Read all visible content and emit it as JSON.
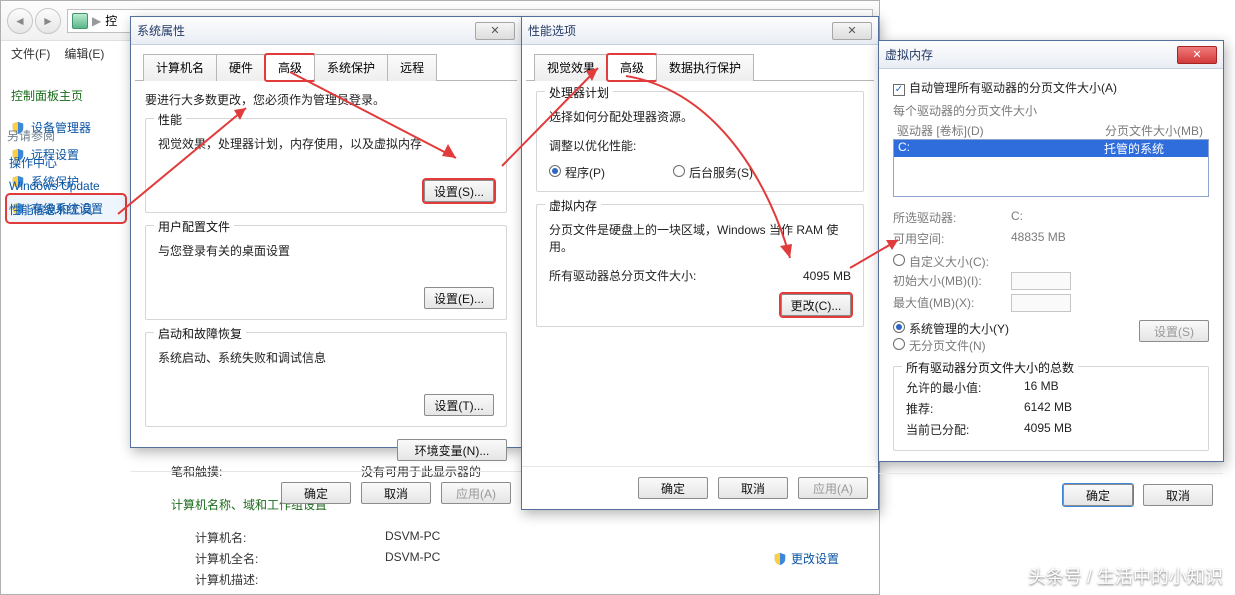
{
  "explorer": {
    "addr_prefix": "▶",
    "addr_text": "控",
    "menu": {
      "file": "文件(F)",
      "edit": "编辑(E)"
    }
  },
  "sidebar": {
    "title": "控制面板主页",
    "items": [
      {
        "label": "设备管理器"
      },
      {
        "label": "远程设置"
      },
      {
        "label": "系统保护"
      },
      {
        "label": "高级系统设置"
      }
    ],
    "footer_title": "另请参阅",
    "footer_items": [
      "操作中心",
      "Windows Update",
      "性能信息和工具"
    ]
  },
  "background": {
    "pen_label": "笔和触摸:",
    "pen_val": "没有可用于此显示器的",
    "cmp_section": "计算机名称、域和工作组设置",
    "cmp_name_l": "计算机名:",
    "cmp_name_v": "DSVM-PC",
    "cmp_full_l": "计算机全名:",
    "cmp_full_v": "DSVM-PC",
    "cmp_desc_l": "计算机描述:",
    "change": "更改设置"
  },
  "win1": {
    "title": "系统属性",
    "tabs": [
      "计算机名",
      "硬件",
      "高级",
      "系统保护",
      "远程"
    ],
    "info": "要进行大多数更改，您必须作为管理员登录。",
    "g1": {
      "title": "性能",
      "desc": "视觉效果，处理器计划，内存使用，以及虚拟内存",
      "btn": "设置(S)..."
    },
    "g2": {
      "title": "用户配置文件",
      "desc": "与您登录有关的桌面设置",
      "btn": "设置(E)..."
    },
    "g3": {
      "title": "启动和故障恢复",
      "desc": "系统启动、系统失败和调试信息",
      "btn": "设置(T)..."
    },
    "env": "环境变量(N)...",
    "ok": "确定",
    "cancel": "取消",
    "apply": "应用(A)"
  },
  "win2": {
    "title": "性能选项",
    "tabs": [
      "视觉效果",
      "高级",
      "数据执行保护"
    ],
    "g1": {
      "title": "处理器计划",
      "desc": "选择如何分配处理器资源。",
      "adjust": "调整以优化性能:",
      "opt1": "程序(P)",
      "opt2": "后台服务(S)"
    },
    "g2": {
      "title": "虚拟内存",
      "desc": "分页文件是硬盘上的一块区域，Windows 当作 RAM 使用。",
      "total_l": "所有驱动器总分页文件大小:",
      "total_v": "4095 MB",
      "btn": "更改(C)..."
    },
    "ok": "确定",
    "cancel": "取消",
    "apply": "应用(A)"
  },
  "win3": {
    "title": "虚拟内存",
    "auto": "自动管理所有驱动器的分页文件大小(A)",
    "each": "每个驱动器的分页文件大小",
    "col1": "驱动器 [卷标](D)",
    "col2": "分页文件大小(MB)",
    "row_drv": "C:",
    "row_val": "托管的系统",
    "sel_drv_l": "所选驱动器:",
    "sel_drv_v": "C:",
    "free_l": "可用空间:",
    "free_v": "48835 MB",
    "custom": "自定义大小(C):",
    "init_l": "初始大小(MB)(I):",
    "max_l": "最大值(MB)(X):",
    "sys": "系统管理的大小(Y)",
    "none": "无分页文件(N)",
    "set": "设置(S)",
    "totals_title": "所有驱动器分页文件大小的总数",
    "min_l": "允许的最小值:",
    "min_v": "16 MB",
    "rec_l": "推荐:",
    "rec_v": "6142 MB",
    "cur_l": "当前已分配:",
    "cur_v": "4095 MB",
    "ok": "确定",
    "cancel": "取消"
  },
  "watermark": "头条号 / 生活中的小知识"
}
